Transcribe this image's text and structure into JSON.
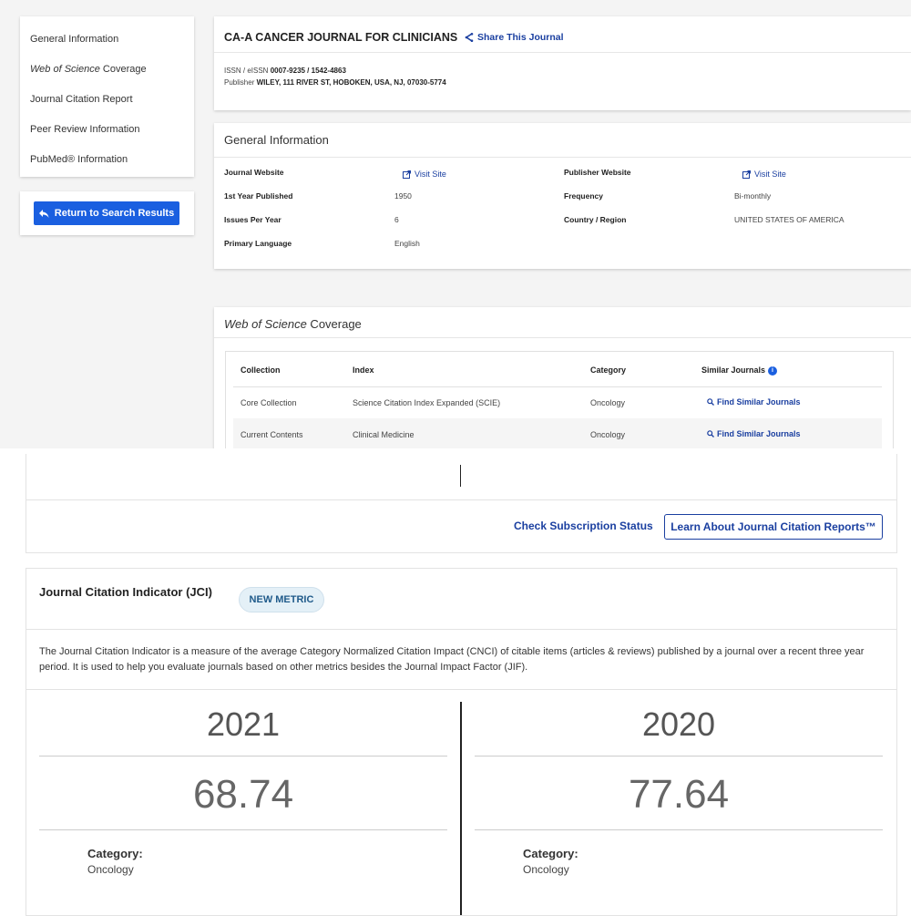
{
  "sidebar": {
    "items": [
      {
        "label": "General Information"
      },
      {
        "label_italic": "Web of Science",
        "label": " Coverage"
      },
      {
        "label": "Journal Citation Report"
      },
      {
        "label": "Peer Review Information"
      },
      {
        "label": "PubMed® Information"
      }
    ],
    "return_button": "Return to Search Results"
  },
  "journal": {
    "title": "CA-A CANCER JOURNAL FOR CLINICIANS",
    "share": "Share This Journal",
    "issn_label": "ISSN / eISSN",
    "issn_value": "0007-9235 / 1542-4863",
    "publisher_label": "Publisher",
    "publisher_value": "WILEY, 111 RIVER ST, HOBOKEN, USA, NJ, 07030-5774"
  },
  "general": {
    "title": "General Information",
    "journal_website_label": "Journal Website",
    "visit_site": "Visit Site",
    "publisher_website_label": "Publisher Website",
    "first_year_label": "1st Year Published",
    "first_year_value": "1950",
    "frequency_label": "Frequency",
    "frequency_value": "Bi-monthly",
    "issues_label": "Issues Per Year",
    "issues_value": "6",
    "country_label": "Country / Region",
    "country_value": "UNITED STATES OF AMERICA",
    "language_label": "Primary Language",
    "language_value": "English"
  },
  "wos": {
    "title_italic": "Web of Science",
    "title_rest": " Coverage",
    "headers": {
      "collection": "Collection",
      "index": "Index",
      "category": "Category",
      "similar": "Similar Journals"
    },
    "rows": [
      {
        "collection": "Core Collection",
        "index": "Science Citation Index Expanded (SCIE)",
        "category": "Oncology",
        "link": "Find Similar Journals"
      },
      {
        "collection": "Current Contents",
        "index": "Clinical Medicine",
        "category": "Oncology",
        "link": "Find Similar Journals"
      }
    ]
  },
  "actions": {
    "check_subscription": "Check Subscription Status",
    "learn_jcr": "Learn About Journal Citation Reports™"
  },
  "jci": {
    "title": "Journal Citation Indicator (JCI)",
    "badge": "NEW METRIC",
    "description": "The Journal Citation Indicator is a measure of the average Category Normalized Citation Impact (CNCI) of citable items (articles & reviews) published by a journal over a recent three year period. It is used to help you evaluate journals based on other metrics besides the Journal Impact Factor (JIF).",
    "columns": [
      {
        "year": "2021",
        "value": "68.74",
        "category_label": "Category:",
        "category": "Oncology"
      },
      {
        "year": "2020",
        "value": "77.64",
        "category_label": "Category:",
        "category": "Oncology"
      }
    ]
  },
  "colors": {
    "link": "#1a3fa0",
    "button": "#1a5fe0",
    "badge_bg": "#e4f0f7"
  }
}
